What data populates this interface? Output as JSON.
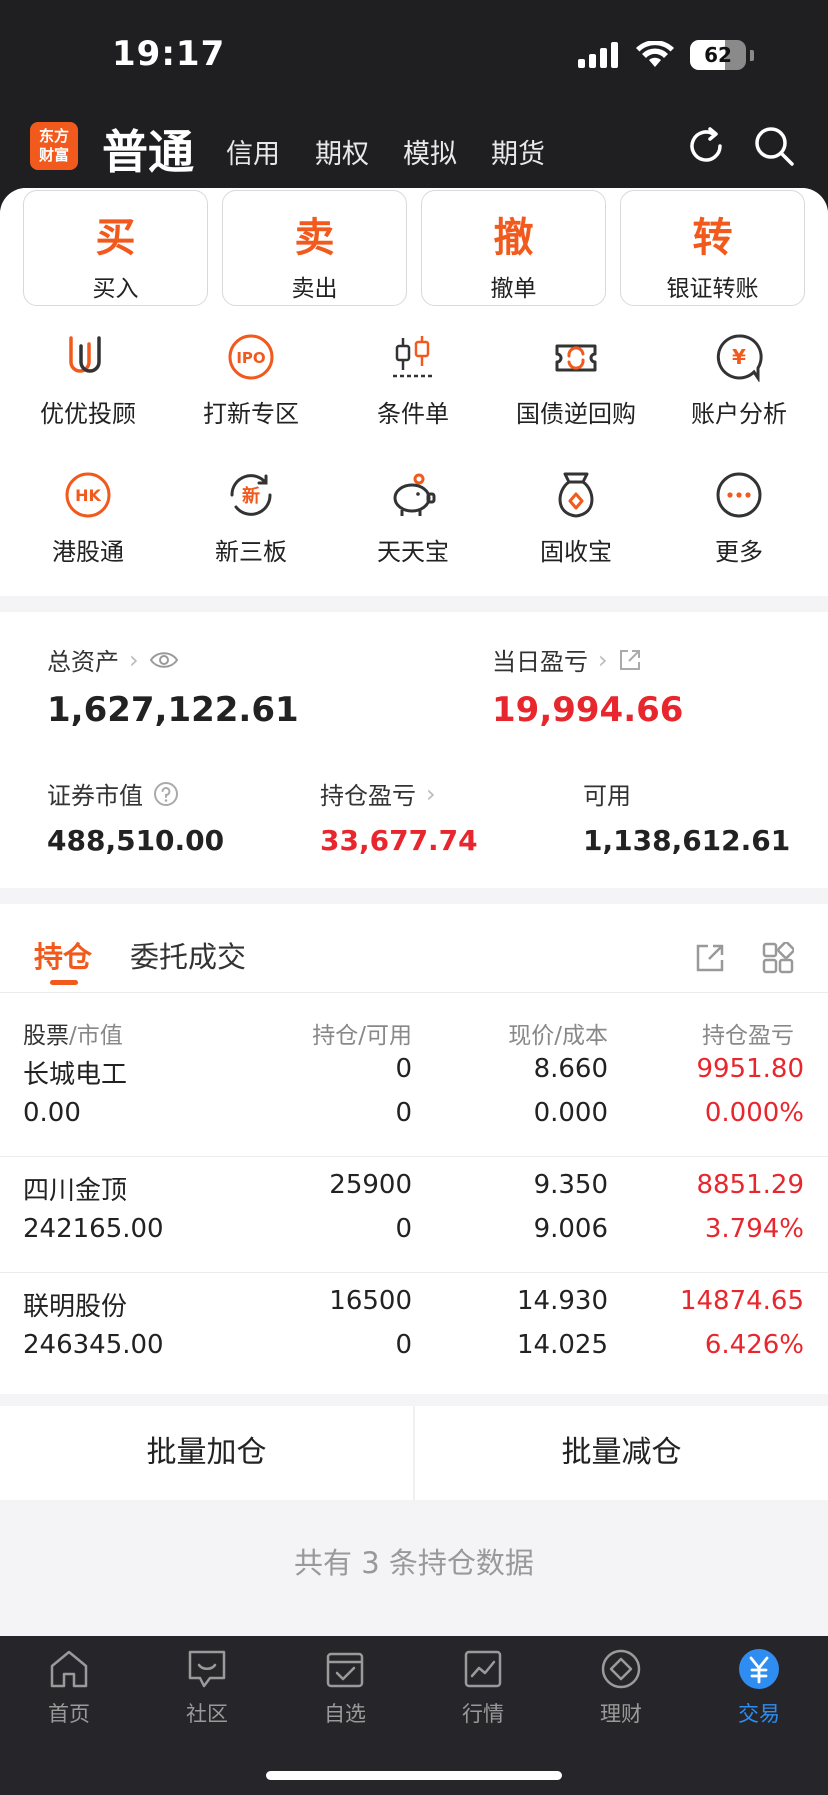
{
  "status": {
    "time": "19:17",
    "battery": "62",
    "battery_level_percent": 62
  },
  "header": {
    "logo_text": "东方财富",
    "tabs": [
      {
        "label": "普通",
        "active": true
      },
      {
        "label": "信用"
      },
      {
        "label": "期权"
      },
      {
        "label": "模拟"
      },
      {
        "label": "期货"
      }
    ],
    "icons": [
      "refresh-icon",
      "search-icon"
    ]
  },
  "quick_actions": [
    {
      "big": "买",
      "small": "买入"
    },
    {
      "big": "卖",
      "small": "卖出"
    },
    {
      "big": "撤",
      "small": "撤单"
    },
    {
      "big": "转",
      "small": "银证转账"
    }
  ],
  "grid": [
    {
      "label": "优优投顾",
      "icon": "uu-advisor-icon"
    },
    {
      "label": "打新专区",
      "icon": "ipo-icon",
      "icon_text": "IPO"
    },
    {
      "label": "条件单",
      "icon": "candlestick-icon"
    },
    {
      "label": "国债逆回购",
      "icon": "repo-icon"
    },
    {
      "label": "账户分析",
      "icon": "yen-chat-icon",
      "icon_text": "¥"
    },
    {
      "label": "港股通",
      "icon": "hk-icon",
      "icon_text": "HK"
    },
    {
      "label": "新三板",
      "icon": "new-board-icon",
      "icon_text": "新"
    },
    {
      "label": "天天宝",
      "icon": "piggy-bank-icon"
    },
    {
      "label": "固收宝",
      "icon": "money-bag-icon"
    },
    {
      "label": "更多",
      "icon": "more-icon"
    }
  ],
  "assets": {
    "total_label": "总资产",
    "total_value": "1,627,122.61",
    "daily_label": "当日盈亏",
    "daily_value": "19,994.66",
    "market_label": "证券市值",
    "market_value": "488,510.00",
    "hold_label": "持仓盈亏",
    "hold_value": "33,677.74",
    "avail_label": "可用",
    "avail_value": "1,138,612.61"
  },
  "positions": {
    "tabs": [
      "持仓",
      "委托成交"
    ],
    "headers": {
      "stock": "股票",
      "stock_sub": "/市值",
      "hold": "持仓/可用",
      "price": "现价/成本",
      "pnl": "持仓盈亏"
    },
    "rows": [
      {
        "name": "长城电工",
        "mv": "0.00",
        "hold": "0",
        "avail": "0",
        "price": "8.660",
        "cost": "0.000",
        "pnl": "9951.80",
        "pct": "0.000%"
      },
      {
        "name": "四川金顶",
        "mv": "242165.00",
        "hold": "25900",
        "avail": "0",
        "price": "9.350",
        "cost": "9.006",
        "pnl": "8851.29",
        "pct": "3.794%"
      },
      {
        "name": "联明股份",
        "mv": "246345.00",
        "hold": "16500",
        "avail": "0",
        "price": "14.930",
        "cost": "14.025",
        "pnl": "14874.65",
        "pct": "6.426%"
      }
    ]
  },
  "batch": {
    "add": "批量加仓",
    "reduce": "批量减仓",
    "count_text": "共有 3 条持仓数据"
  },
  "nav": [
    {
      "label": "首页",
      "icon": "home-icon"
    },
    {
      "label": "社区",
      "icon": "community-icon"
    },
    {
      "label": "自选",
      "icon": "watchlist-icon"
    },
    {
      "label": "行情",
      "icon": "market-icon"
    },
    {
      "label": "理财",
      "icon": "wealth-icon"
    },
    {
      "label": "交易",
      "icon": "yen-trade-icon",
      "active": true
    }
  ],
  "colors": {
    "accent": "#f25a1d",
    "red": "#e8262d",
    "nav_active": "#2f8cf0"
  }
}
